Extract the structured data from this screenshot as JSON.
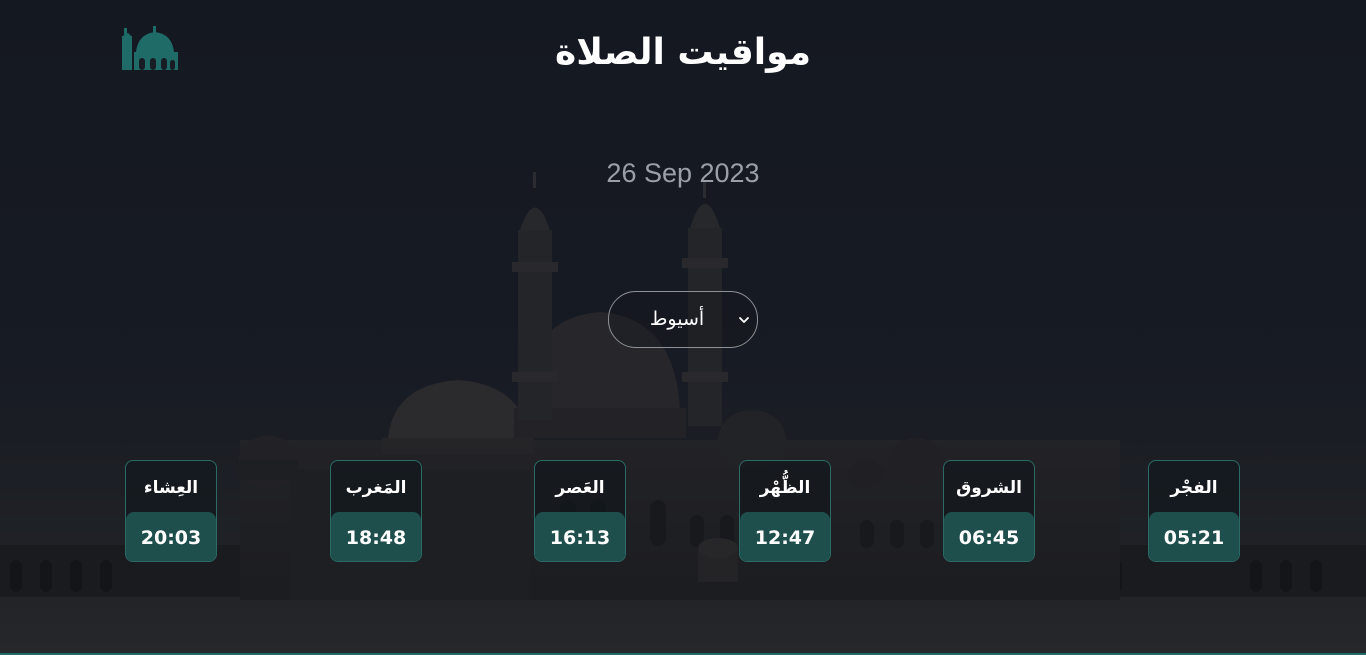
{
  "header": {
    "title": "مواقيت الصلاة",
    "logo_icon": "mosque-icon"
  },
  "date": "26 Sep 2023",
  "city_select": {
    "selected": "أسيوط",
    "icon": "chevron-down-icon"
  },
  "prayers": [
    {
      "name": "الفجْر",
      "time": "05:21"
    },
    {
      "name": "الشروق",
      "time": "06:45"
    },
    {
      "name": "الظُّهْر",
      "time": "12:47"
    },
    {
      "name": "العَصر",
      "time": "16:13"
    },
    {
      "name": "المَغرب",
      "time": "18:48"
    },
    {
      "name": "العِشاء",
      "time": "20:03"
    }
  ],
  "colors": {
    "accent": "#1f4f4d",
    "accent_border": "#2a6b66",
    "logo": "#1e6b68",
    "background": "#181c24",
    "date_text": "#9aa0a6"
  }
}
